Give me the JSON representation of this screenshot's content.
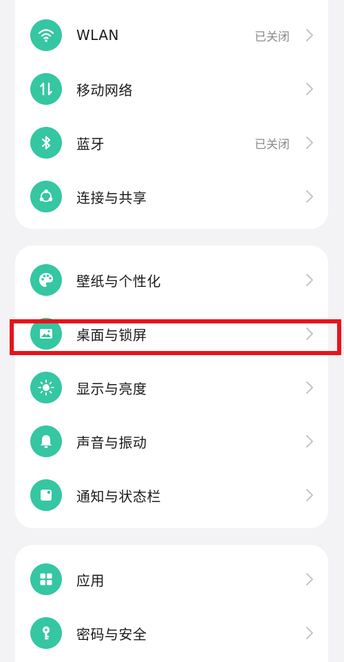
{
  "colors": {
    "accent": "#35c6a2",
    "highlight": "#e8131b",
    "background": "#f3f2f4"
  },
  "group1": {
    "items": [
      {
        "label": "WLAN",
        "status": "已关闭",
        "icon": "wifi-icon"
      },
      {
        "label": "移动网络",
        "status": "",
        "icon": "mobile-data-icon"
      },
      {
        "label": "蓝牙",
        "status": "已关闭",
        "icon": "bluetooth-icon"
      },
      {
        "label": "连接与共享",
        "status": "",
        "icon": "share-icon"
      }
    ]
  },
  "group2": {
    "items": [
      {
        "label": "壁纸与个性化",
        "icon": "palette-icon"
      },
      {
        "label": "桌面与锁屏",
        "icon": "image-icon"
      },
      {
        "label": "显示与亮度",
        "icon": "sun-icon"
      },
      {
        "label": "声音与振动",
        "icon": "bell-icon"
      },
      {
        "label": "通知与状态栏",
        "icon": "notification-icon"
      }
    ]
  },
  "group3": {
    "items": [
      {
        "label": "应用",
        "icon": "apps-grid-icon"
      },
      {
        "label": "密码与安全",
        "icon": "key-icon"
      }
    ]
  }
}
